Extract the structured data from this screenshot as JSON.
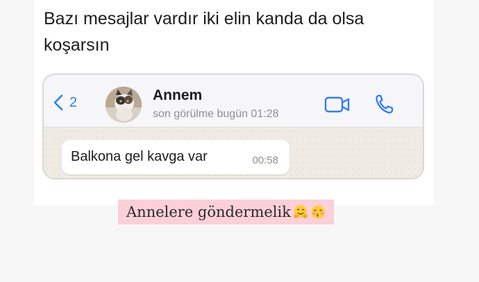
{
  "post": {
    "text": "Bazı mesajlar vardır iki elin kanda da olsa koşarsın"
  },
  "chat": {
    "back_count": "2",
    "contact_name": "Annem",
    "last_seen": "son görülme bugün 01:28",
    "message": {
      "text": "Balkona gel kavga var",
      "time": "00:58"
    }
  },
  "caption": {
    "text": "Annelere göndermelik",
    "emojis": [
      "hugging-face",
      "face-blowing-kiss"
    ]
  },
  "colors": {
    "ios_blue": "#2f7cf6",
    "caption_bg": "#fbd0d8",
    "chat_bg": "#efeae2"
  }
}
